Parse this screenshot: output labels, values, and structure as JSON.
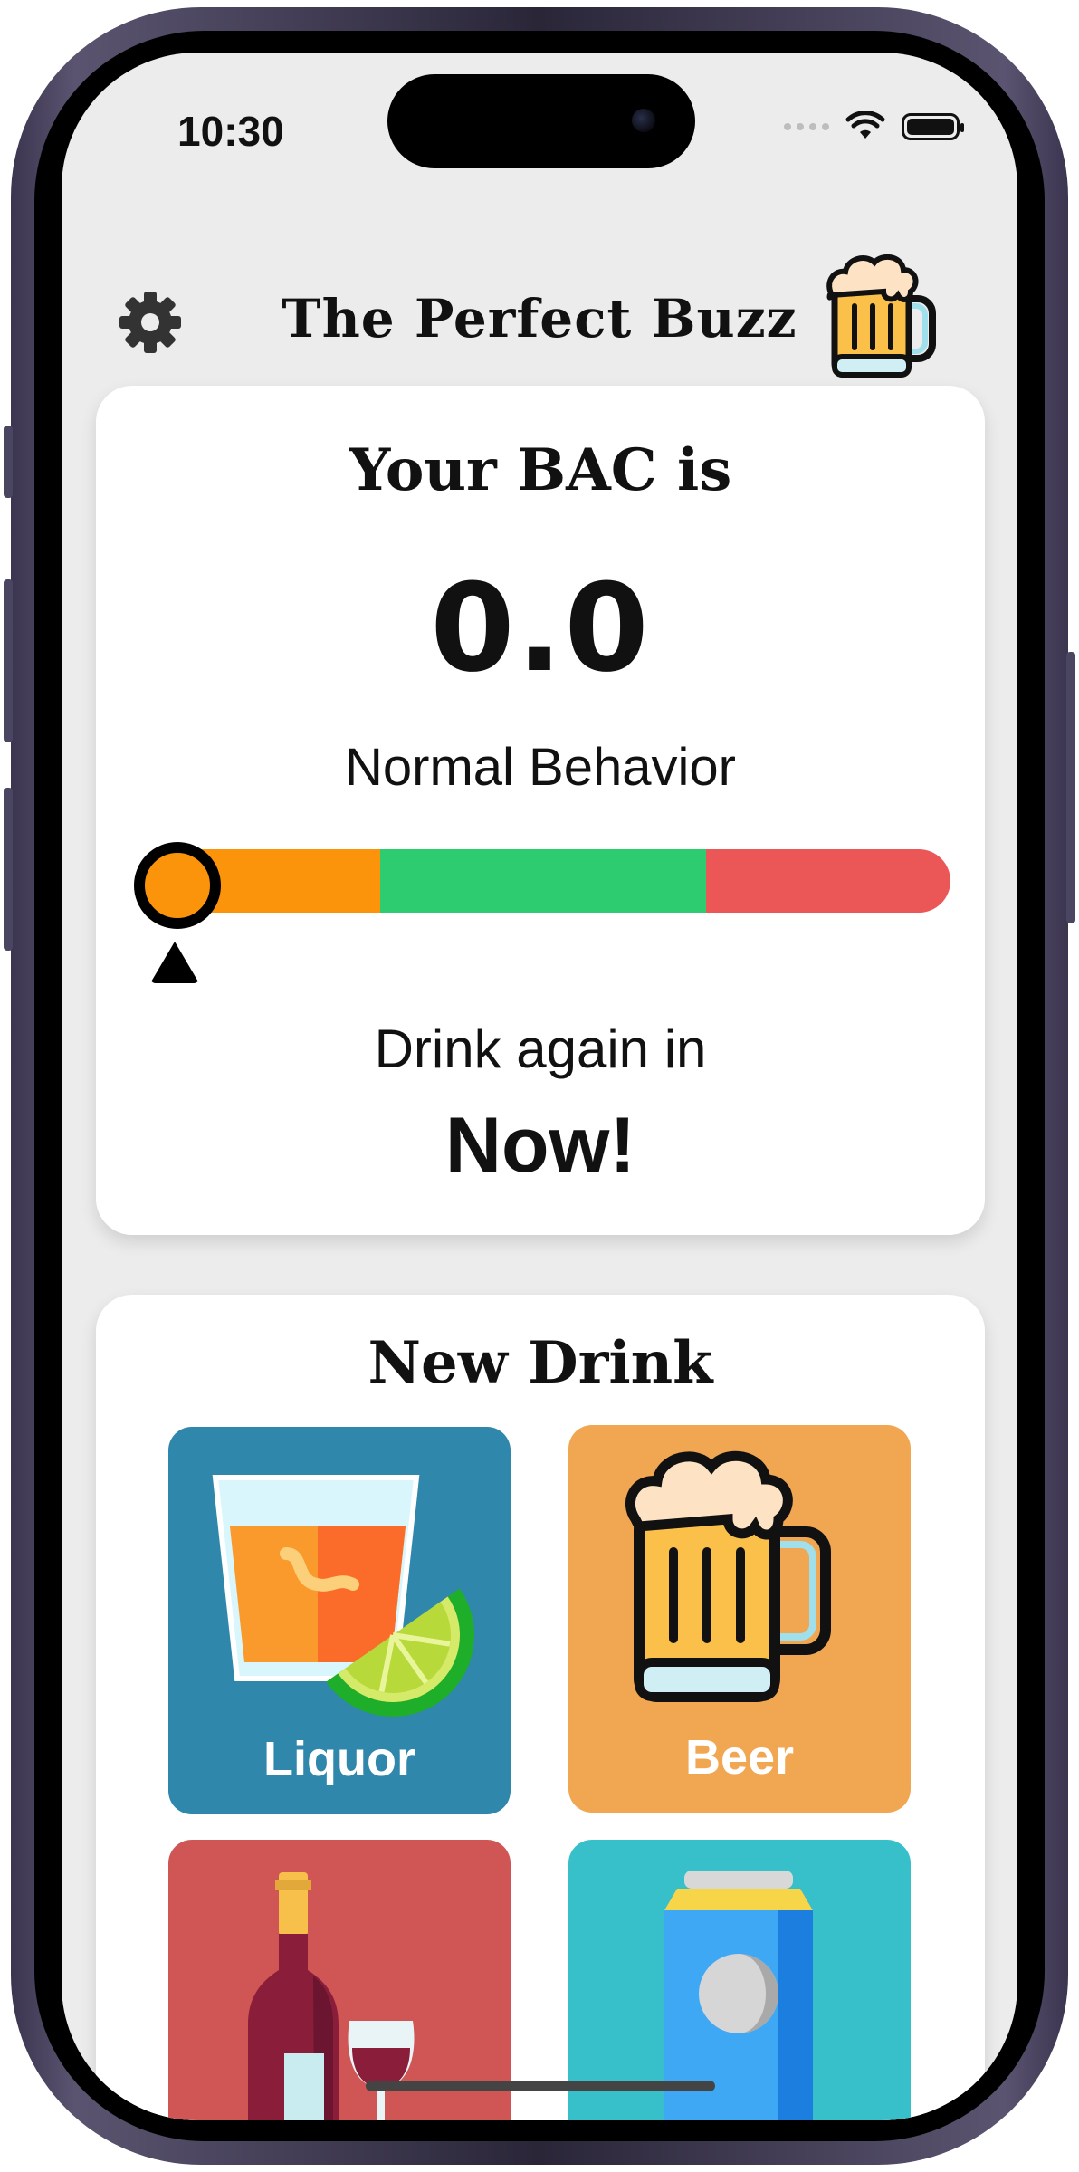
{
  "status_bar": {
    "time": "10:30"
  },
  "header": {
    "title": "The Perfect Buzz",
    "settings_icon": "gear-icon",
    "logo_icon": "beer-mug-icon"
  },
  "bac_card": {
    "heading": "Your BAC is",
    "value": "0.0",
    "status": "Normal Behavior",
    "meter": {
      "position_fraction": 0.0,
      "segments": [
        {
          "color": "#fb930b",
          "fraction": 0.3
        },
        {
          "color": "#2ecc71",
          "fraction": 0.4
        },
        {
          "color": "#eb5757",
          "fraction": 0.3
        }
      ]
    },
    "drink_again_label": "Drink again in",
    "drink_again_value": "Now!"
  },
  "new_drink": {
    "heading": "New Drink",
    "tiles": [
      {
        "label": "Liquor",
        "color": "#2f87ab",
        "icon": "liquor-glass-icon"
      },
      {
        "label": "Beer",
        "color": "#f1a652",
        "icon": "beer-mug-icon"
      },
      {
        "label": "",
        "color": "#d05555",
        "icon": "wine-bottle-icon"
      },
      {
        "label": "",
        "color": "#37c0c9",
        "icon": "soda-can-icon"
      }
    ]
  }
}
